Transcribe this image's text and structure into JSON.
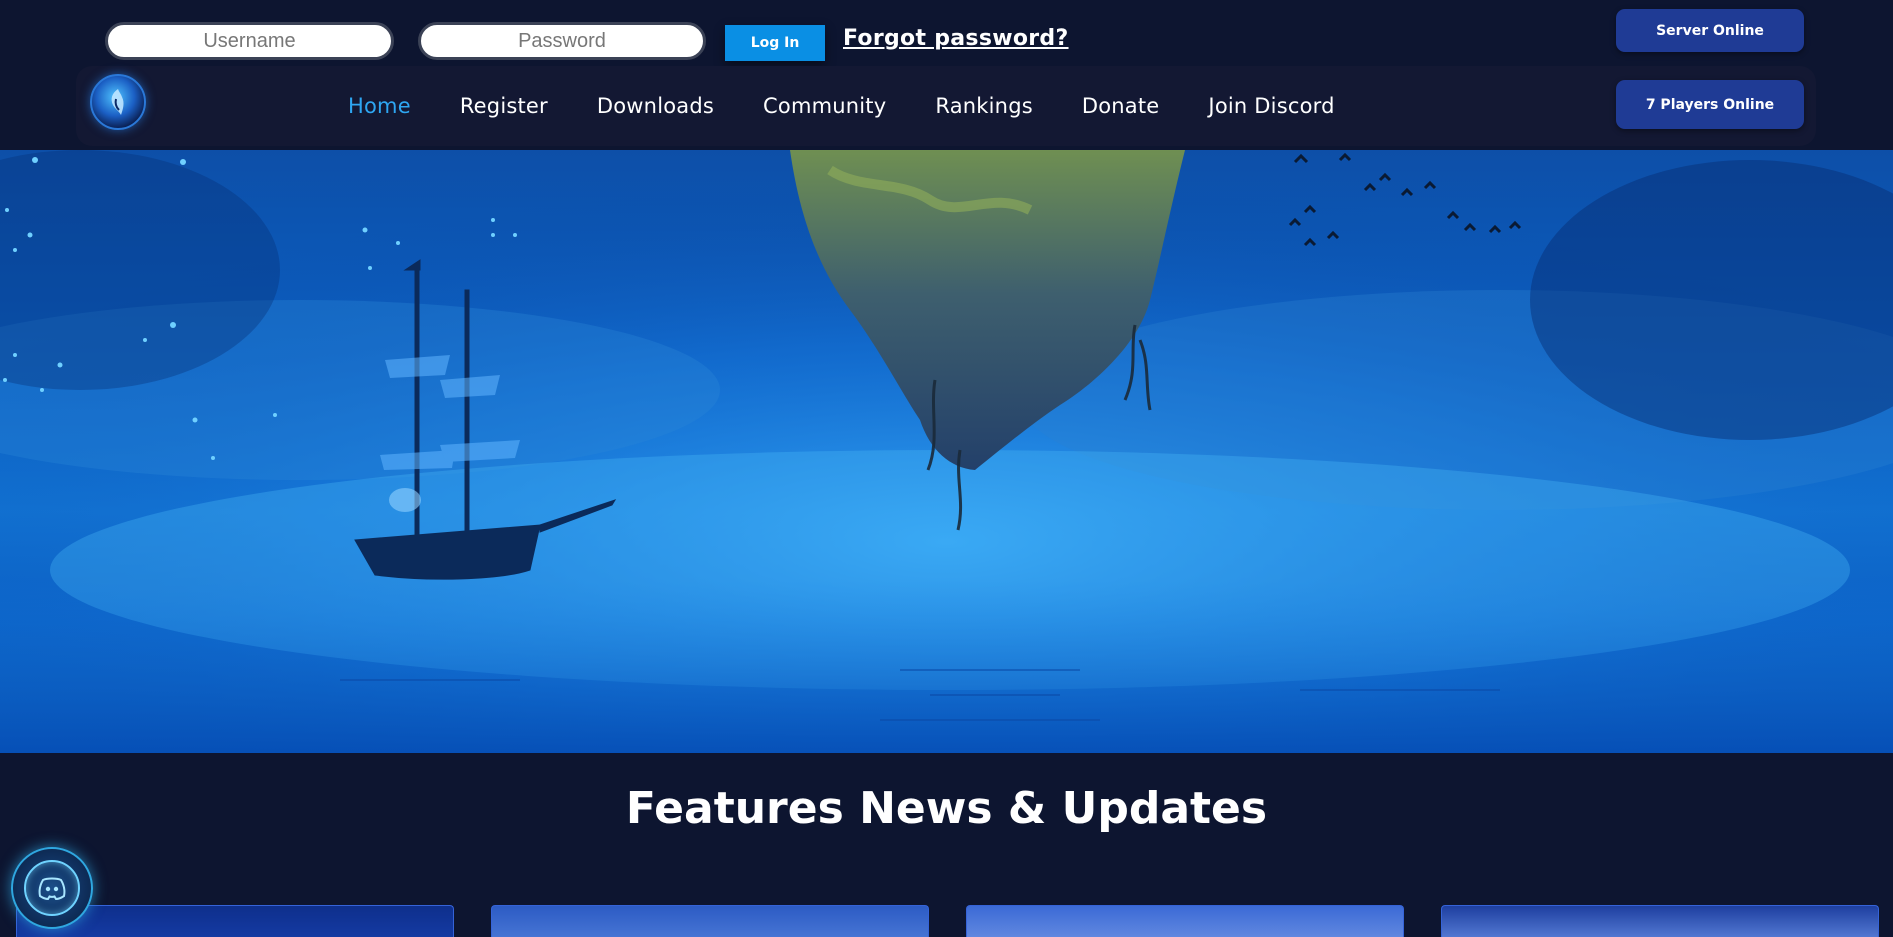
{
  "login": {
    "username_placeholder": "Username",
    "password_placeholder": "Password",
    "login_label": "Log In",
    "forgot_label": "Forgot password?"
  },
  "status": {
    "server": "Server Online",
    "players": "7 Players Online"
  },
  "nav": {
    "items": [
      {
        "label": "Home",
        "active": true
      },
      {
        "label": "Register",
        "active": false
      },
      {
        "label": "Downloads",
        "active": false
      },
      {
        "label": "Community",
        "active": false
      },
      {
        "label": "Rankings",
        "active": false
      },
      {
        "label": "Donate",
        "active": false
      },
      {
        "label": "Join Discord",
        "active": false
      }
    ]
  },
  "features": {
    "title": "Features News & Updates"
  },
  "icons": {
    "logo": "game-logo-icon",
    "discord": "discord-icon"
  },
  "colors": {
    "page_background": "#0d1530",
    "navbar_background": "#131833",
    "active_nav": "#2ea6f2",
    "login_button": "#0a8fe4",
    "status_pill": "#1f3b95"
  }
}
